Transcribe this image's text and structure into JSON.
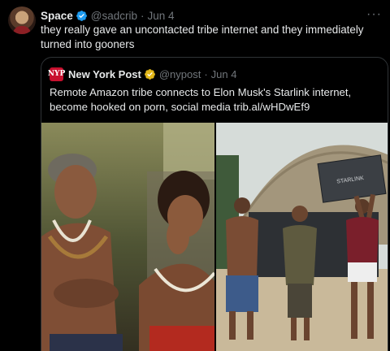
{
  "post": {
    "author_name": "Space",
    "handle": "@sadcrib",
    "dot": "·",
    "date": "Jun 4",
    "more": "···",
    "text": "they really gave an uncontacted tribe internet and they immediately turned into gooners"
  },
  "quoted": {
    "logo_text": "NYP",
    "author_name": "New York Post",
    "handle": "@nypost",
    "dot": "·",
    "date": "Jun 4",
    "text": "Remote Amazon tribe connects to Elon Musk's Starlink internet, become hooked on porn, social media trib.al/wHDwEf9",
    "box_label": "STARLINK"
  },
  "colors": {
    "verified_blue": "#1d9bf0",
    "verified_gold": "#e2b719",
    "brand_red": "#c8102e"
  }
}
